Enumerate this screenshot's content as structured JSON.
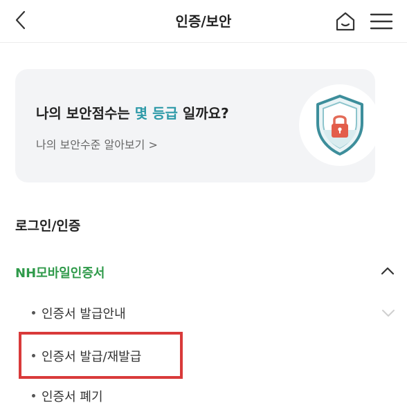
{
  "header": {
    "title": "인증/보안",
    "back_icon": "back-chevron-icon",
    "home_icon": "home-icon",
    "menu_icon": "hamburger-menu-icon"
  },
  "security_card": {
    "headline_prefix": "나의 보안점수는 ",
    "headline_accent": "몇 등급",
    "headline_suffix": " 일까요?",
    "subtext": "나의 보안수준 알아보기 >",
    "icon": "security-shield-lock-icon",
    "accent_color": "#2e9aa8"
  },
  "section": {
    "title": "로그인/인증"
  },
  "group": {
    "label": "NH모바일인증서",
    "expanded": true,
    "color": "#2f9a4a"
  },
  "items": [
    {
      "label": "인증서 발급안내",
      "has_chevron": true
    },
    {
      "label": "인증서 발급/재발급",
      "highlighted": true
    },
    {
      "label": "인증서 폐기"
    }
  ],
  "highlight_color": "#d93a3a"
}
